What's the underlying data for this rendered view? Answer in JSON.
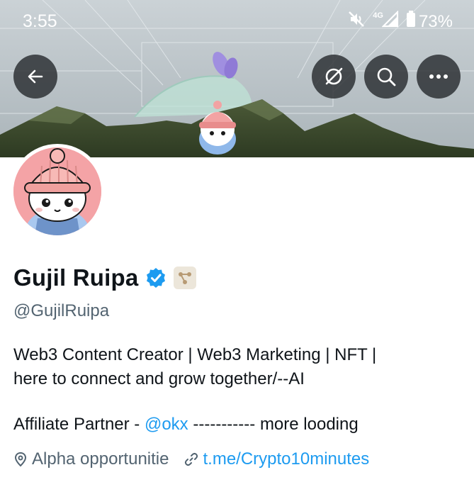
{
  "status_bar": {
    "time": "3:55",
    "network": "4G",
    "battery": "73%",
    "icons": [
      "mute-icon",
      "signal-icon",
      "battery-icon"
    ]
  },
  "header_actions": {
    "back": "back-arrow-icon",
    "grok": "grok-icon",
    "search": "search-icon",
    "more": "more-icon"
  },
  "profile": {
    "display_name": "Gujil Ruipa",
    "handle": "@GujilRuipa",
    "verified_icon": "verified-badge-icon",
    "affiliate_badge": "affiliate-badge-icon",
    "bio_line1": "Web3 Content Creator | Web3 Marketing | NFT |",
    "bio_line2": "here to connect and grow together/--AI",
    "bio_line3_prefix": "Affiliate Partner - ",
    "bio_line3_mention": "@okx",
    "bio_line3_suffix": " ----------- more looding",
    "location": "Alpha opportunitie",
    "website": "t.me/Crypto10minutes"
  },
  "colors": {
    "link": "#1d9bf0",
    "secondary_text": "#536471",
    "primary_text": "#0f1419",
    "avatar_bg": "#f4a3a6"
  }
}
